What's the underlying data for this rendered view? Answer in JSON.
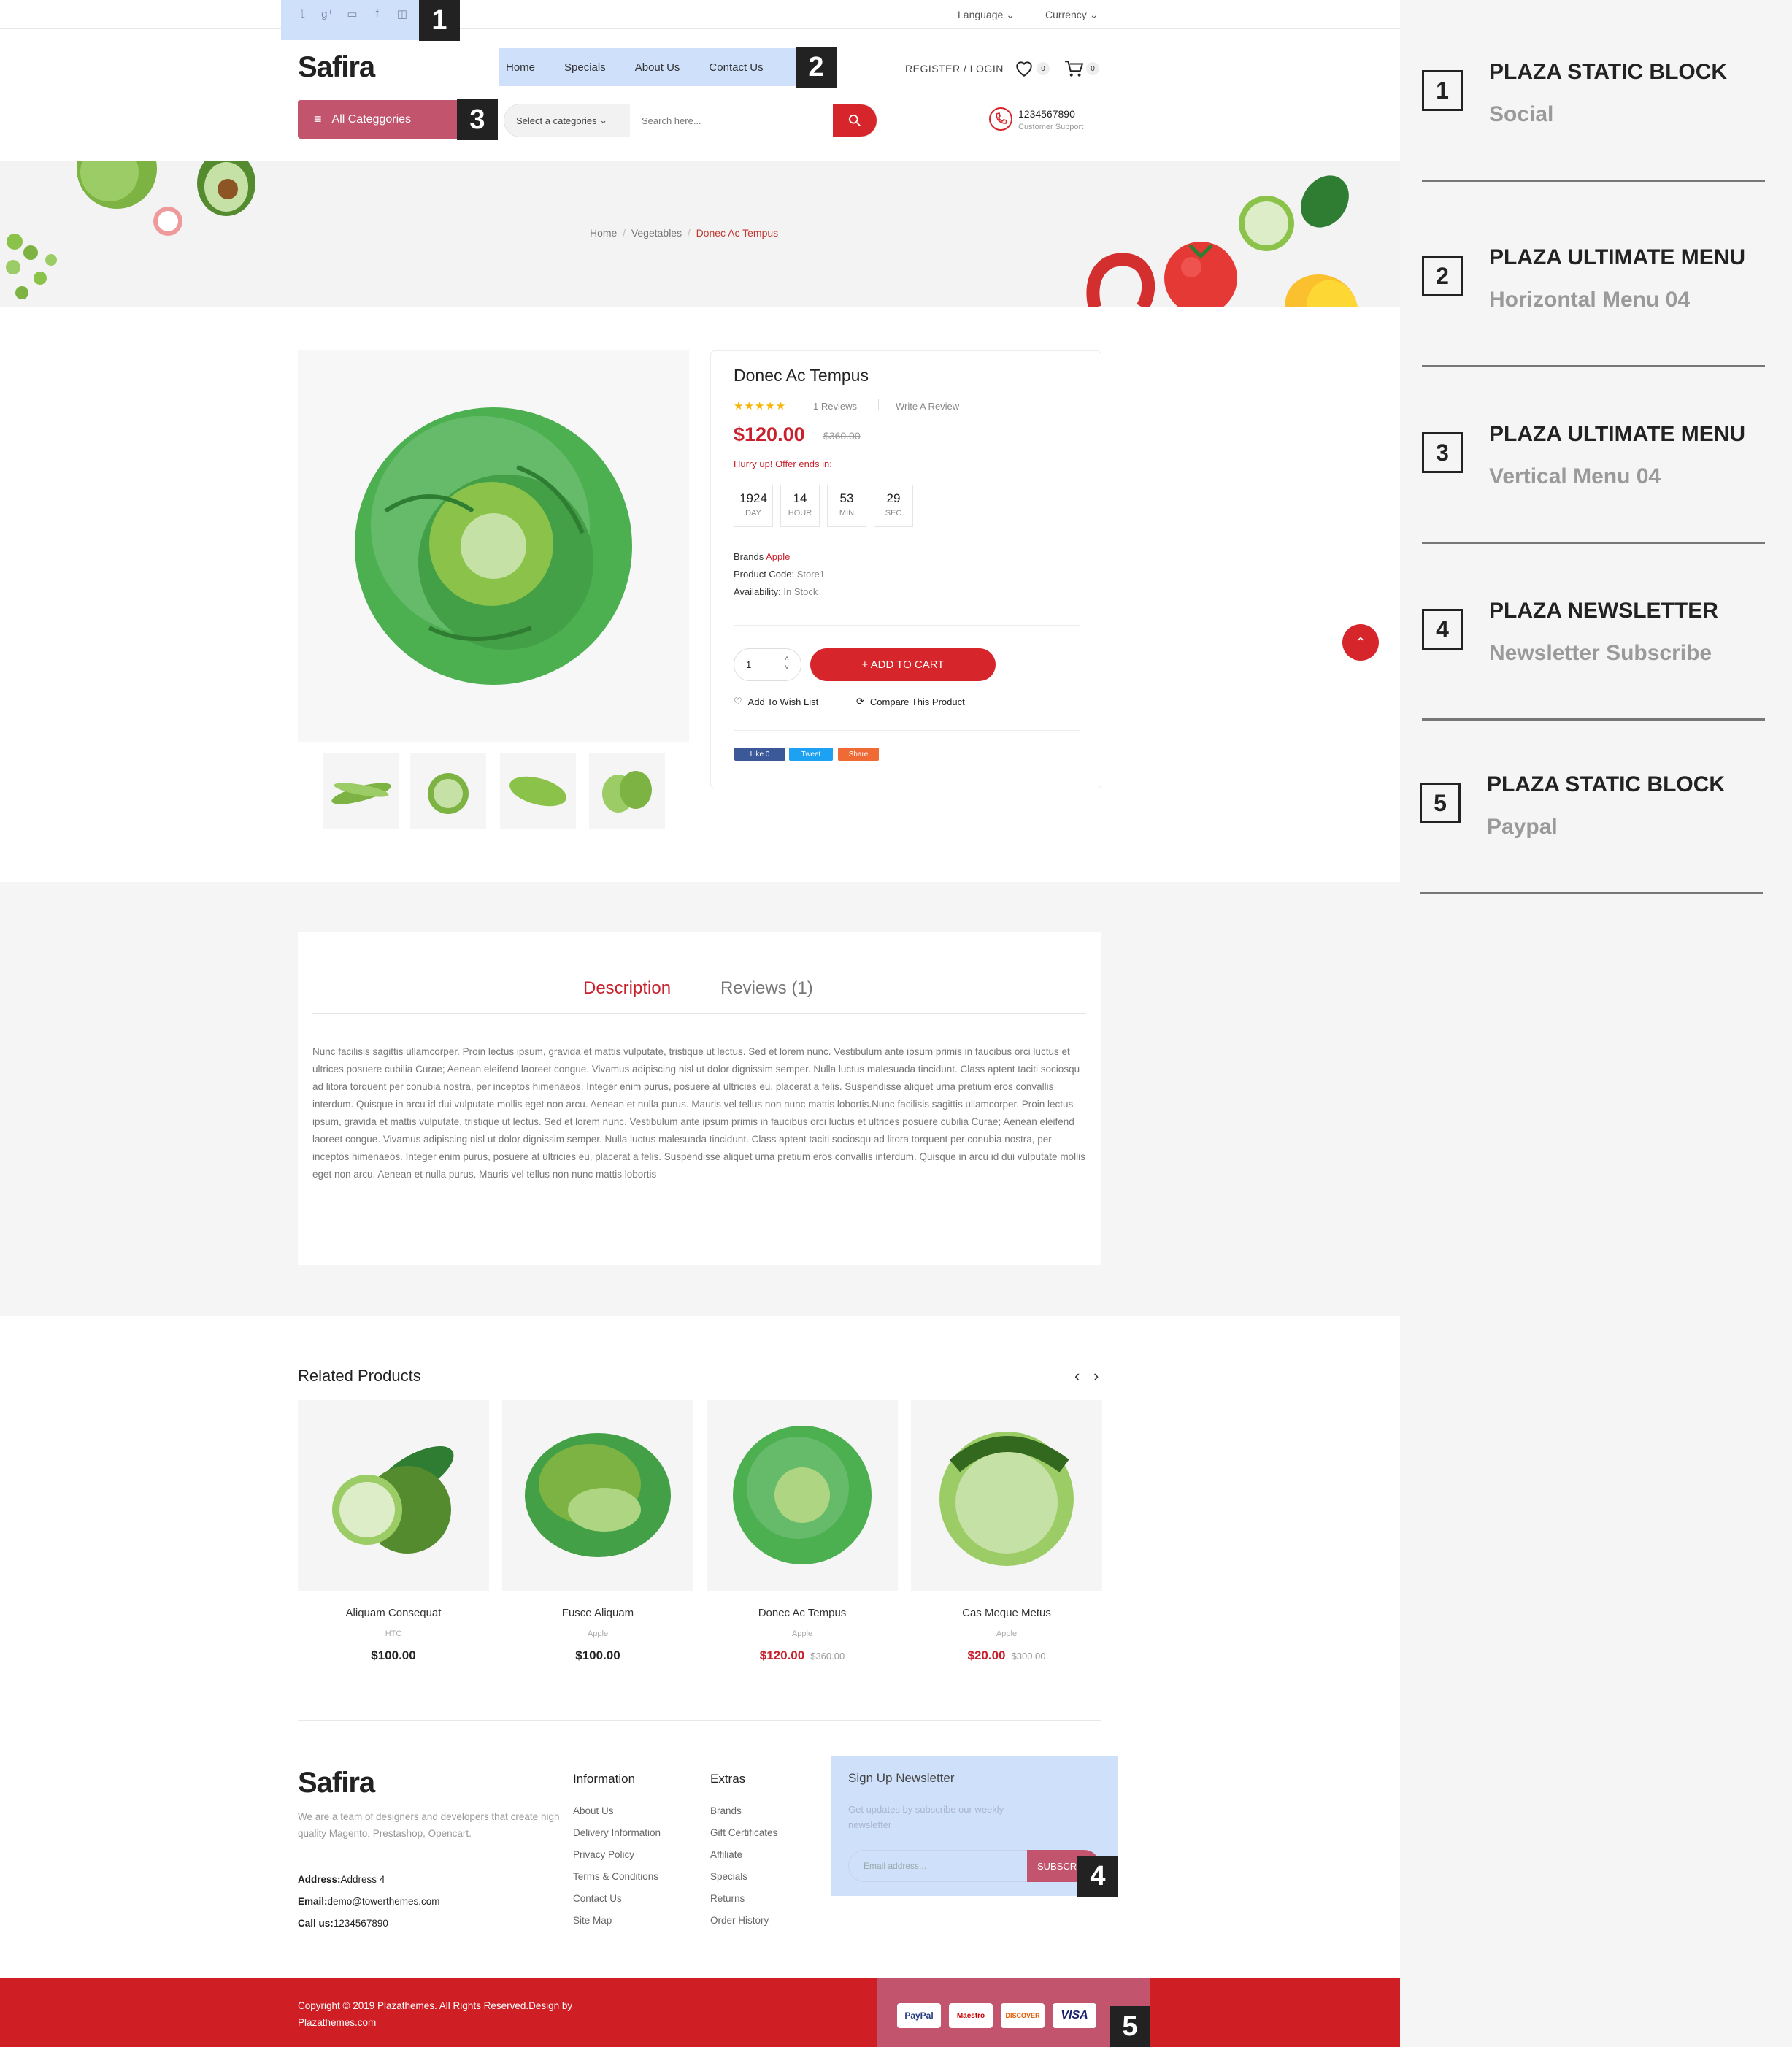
{
  "topbar": {
    "language": "Language",
    "currency": "Currency",
    "social_icons": [
      "twitter-icon",
      "google-plus-icon",
      "youtube-icon",
      "facebook-icon",
      "instagram-icon"
    ]
  },
  "header": {
    "logo": "Safira",
    "nav": [
      "Home",
      "Specials",
      "About Us",
      "Contact Us"
    ],
    "register": "REGISTER",
    "login": "LOGIN",
    "sep": "/",
    "wishlist_count": "0",
    "cart_count": "0",
    "all_categories": "All Categgories",
    "category_select": "Select a categories",
    "search_placeholder": "Search here...",
    "phone": "1234567890",
    "support": "Customer Support"
  },
  "badges": [
    "1",
    "2",
    "3",
    "4",
    "5"
  ],
  "breadcrumb": {
    "home": "Home",
    "sep": "/",
    "cat": "Vegetables",
    "current": "Donec Ac Tempus"
  },
  "product": {
    "name": "Donec Ac Tempus",
    "stars": "★★★★★",
    "reviews": "1 Reviews",
    "write_review": "Write A Review",
    "price": "$120.00",
    "old_price": "$360.00",
    "hurry": "Hurry up! Offer ends in:",
    "countdown": [
      {
        "n": "1924",
        "l": "DAY"
      },
      {
        "n": "14",
        "l": "HOUR"
      },
      {
        "n": "53",
        "l": "MIN"
      },
      {
        "n": "29",
        "l": "SEC"
      }
    ],
    "brand_label": "Brands",
    "brand": "Apple",
    "code_label": "Product Code:",
    "code": "Store1",
    "avail_label": "Availability:",
    "avail": "In Stock",
    "qty": "1",
    "add_to_cart": "+ ADD TO CART",
    "wishlist": "Add To Wish List",
    "compare": "Compare This Product",
    "share": {
      "like": "Like 0",
      "tweet": "Tweet",
      "share": "Share"
    }
  },
  "tabs": {
    "description": "Description",
    "reviews": "Reviews (1)",
    "text": "Nunc facilisis sagittis ullamcorper. Proin lectus ipsum, gravida et mattis vulputate, tristique ut lectus. Sed et lorem nunc. Vestibulum ante ipsum primis in faucibus orci luctus et ultrices posuere cubilia Curae; Aenean eleifend laoreet congue. Vivamus adipiscing nisl ut dolor dignissim semper. Nulla luctus malesuada tincidunt. Class aptent taciti sociosqu ad litora torquent per conubia nostra, per inceptos himenaeos. Integer enim purus, posuere at ultricies eu, placerat a felis. Suspendisse aliquet urna pretium eros convallis interdum. Quisque in arcu id dui vulputate mollis eget non arcu. Aenean et nulla purus. Mauris vel tellus non nunc mattis lobortis.Nunc facilisis sagittis ullamcorper. Proin lectus ipsum, gravida et mattis vulputate, tristique ut lectus. Sed et lorem nunc. Vestibulum ante ipsum primis in faucibus orci luctus et ultrices posuere cubilia Curae; Aenean eleifend laoreet congue. Vivamus adipiscing nisl ut dolor dignissim semper. Nulla luctus malesuada tincidunt. Class aptent taciti sociosqu ad litora torquent per conubia nostra, per inceptos himenaeos. Integer enim purus, posuere at ultricies eu, placerat a felis. Suspendisse aliquet urna pretium eros convallis interdum. Quisque in arcu id dui vulputate mollis eget non arcu. Aenean et nulla purus. Mauris vel tellus non nunc mattis lobortis"
  },
  "related": {
    "title": "Related Products",
    "items": [
      {
        "name": "Aliquam Consequat",
        "brand": "HTC",
        "price": "$100.00",
        "old": ""
      },
      {
        "name": "Fusce Aliquam",
        "brand": "Apple",
        "price": "$100.00",
        "old": ""
      },
      {
        "name": "Donec Ac Tempus",
        "brand": "Apple",
        "price": "$120.00",
        "old": "$360.00"
      },
      {
        "name": "Cas Meque Metus",
        "brand": "Apple",
        "price": "$20.00",
        "old": "$300.00"
      }
    ]
  },
  "footer": {
    "logo": "Safira",
    "about": "We are a team of designers and developers that create high quality Magento, Prestashop, Opencart.",
    "address_label": "Address:",
    "address": "Address 4",
    "email_label": "Email:",
    "email": "demo@towerthemes.com",
    "call_label": "Call us:",
    "call": "1234567890",
    "info_title": "Information",
    "info_links": [
      "About Us",
      "Delivery Information",
      "Privacy Policy",
      "Terms & Conditions",
      "Contact Us",
      "Site Map"
    ],
    "extras_title": "Extras",
    "extras_links": [
      "Brands",
      "Gift Certificates",
      "Affiliate",
      "Specials",
      "Returns",
      "Order History"
    ],
    "news_title": "Sign Up Newsletter",
    "news_text": "Get updates by subscribe our weekly newsletter",
    "news_placeholder": "Email address...",
    "subscribe": "SUBSCR",
    "copyright": "Copyright © 2019 Plazathemes. All Rights Reserved.Design by Plazathemes.com",
    "payments": [
      "PayPal",
      "Maestro",
      "DISCOVER",
      "VISA"
    ]
  },
  "side": [
    {
      "n": "1",
      "t": "PLAZA STATIC BLOCK",
      "s": "Social"
    },
    {
      "n": "2",
      "t": "PLAZA ULTIMATE MENU",
      "s": "Horizontal Menu 04"
    },
    {
      "n": "3",
      "t": "PLAZA ULTIMATE MENU",
      "s": "Vertical Menu 04"
    },
    {
      "n": "4",
      "t": "PLAZA NEWSLETTER",
      "s": "Newsletter Subscribe"
    },
    {
      "n": "5",
      "t": "PLAZA STATIC BLOCK",
      "s": "Paypal"
    }
  ],
  "colors": {
    "accent": "#d7262b",
    "highlight": "#cfe0fb",
    "pink": "#c2546e"
  }
}
